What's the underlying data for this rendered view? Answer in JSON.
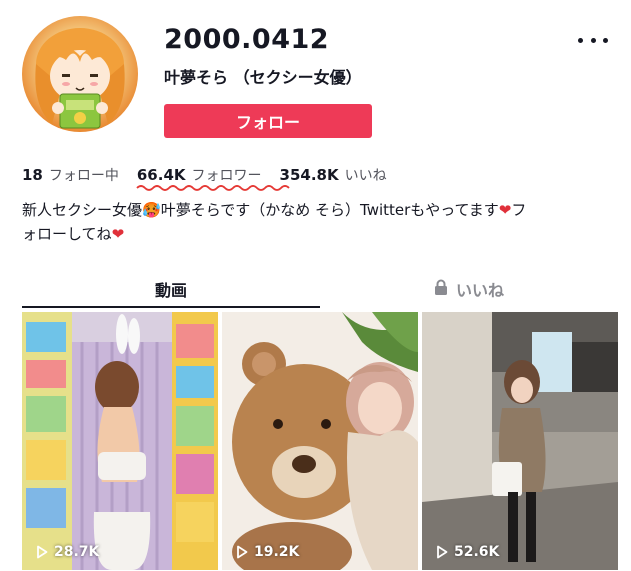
{
  "profile": {
    "username": "2000.0412",
    "nickname": "叶夢そら （セクシー女優）",
    "follow_label": "フォロー",
    "more_icon": "more-horizontal-icon"
  },
  "stats": {
    "following_count": "18",
    "following_label": "フォロー中",
    "followers_count": "66.4K",
    "followers_label": "フォロワー",
    "likes_count": "354.8K",
    "likes_label": "いいね"
  },
  "bio": {
    "line1_text": "新人セクシー女優",
    "line1_text_b": "叶夢そらです（かなめ そら）Twitterもやってます",
    "line1_text_c": "フ",
    "line2_text": "ォローしてね",
    "emoji_face": "🥵",
    "emoji_heart": "❤"
  },
  "tabs": [
    {
      "label": "動画",
      "active": true
    },
    {
      "label": "いいね",
      "active": false,
      "icon": "lock-icon"
    }
  ],
  "videos": [
    {
      "views": "28.7K"
    },
    {
      "views": "19.2K"
    },
    {
      "views": "52.6K"
    }
  ],
  "colors": {
    "accent": "#ee3a57",
    "text": "#161823",
    "muted": "#8a8b91",
    "squiggle": "#e53935"
  }
}
